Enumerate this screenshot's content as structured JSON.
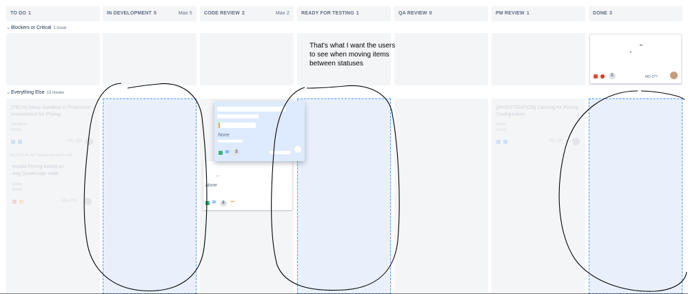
{
  "columns": [
    {
      "name": "TO DO",
      "count": "1",
      "max": ""
    },
    {
      "name": "IN DEVELOPMENT",
      "count": "5",
      "max": "Max 5"
    },
    {
      "name": "CODE REVIEW",
      "count": "2",
      "max": "Max 2"
    },
    {
      "name": "READY FOR TESTING",
      "count": "1",
      "max": ""
    },
    {
      "name": "QA REVIEW",
      "count": "0",
      "max": ""
    },
    {
      "name": "PM REVIEW",
      "count": "1",
      "max": ""
    },
    {
      "name": "DONE",
      "count": "3",
      "max": ""
    }
  ],
  "swimlanes": [
    {
      "title": "Blockers or Critical",
      "issues": "1 issue"
    },
    {
      "title": "Everything Else",
      "issues": "13 issues"
    }
  ],
  "annotation": "That's what I want the users to see when moving items between statuses",
  "cards": {
    "todo_1": {
      "title_l1": "[TECH] Setup Sandbox in Production",
      "title_l2": "environment for Pricing",
      "tag": "Sandbox",
      "meta": "None",
      "key": "MD-261"
    },
    "todo_2_header": "TECHNICAL Add Testing through the API",
    "todo_2": {
      "title_l1": "Invalid Pricing based on",
      "title_l2": "Avg QuoteLogic table",
      "tag": "None",
      "meta": "None",
      "key": "MD-299"
    },
    "code_review_1": {
      "meta": "None",
      "points": "5"
    },
    "code_review_2": {
      "meta": "None",
      "points": "8",
      "dots": "•••",
      "ellipsis": "..."
    },
    "pm_review_1": {
      "title_l1": "[INVESTIGATION] Caching for Pricing",
      "title_l2": "Configuration",
      "tag": "None",
      "meta": "None",
      "key": "MD-287"
    },
    "done_1": {
      "points": "5",
      "key": "MD-2??"
    }
  },
  "colors": {
    "column_bg": "#f4f5f7",
    "drop_zone": "#e9f0fb",
    "drop_border": "#4c9aff",
    "dragged_card": "#deebff",
    "story": "#36b37e",
    "bug": "#e5493a",
    "priority": "#2684ff"
  }
}
